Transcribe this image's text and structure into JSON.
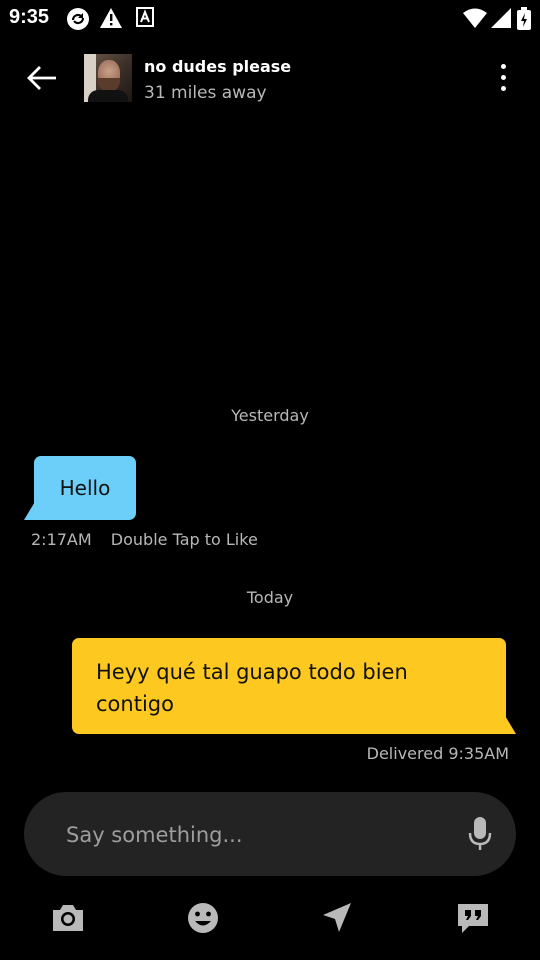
{
  "status_bar": {
    "time": "9:35",
    "icons": [
      "sync-icon",
      "warning-icon",
      "font-a-icon",
      "wifi-icon",
      "signal-icon",
      "battery-icon"
    ]
  },
  "header": {
    "contact_name": "no dudes please",
    "distance": "31 miles away",
    "icons": [
      "back-arrow-icon",
      "more-vert-icon"
    ]
  },
  "chat": {
    "date_yesterday": "Yesterday",
    "incoming": {
      "text": "Hello",
      "time": "2:17AM",
      "like_hint": "Double Tap to Like",
      "color": "#6ccff9"
    },
    "date_today": "Today",
    "outgoing": {
      "text": "Heyy qué tal guapo todo bien contigo",
      "status": "Delivered 9:35AM",
      "color": "#fdc81f"
    }
  },
  "composer": {
    "placeholder": "Say something...",
    "mic_icon": "microphone-icon"
  },
  "toolbar": {
    "items": [
      "camera-icon",
      "emoji-icon",
      "location-send-icon",
      "saved-phrases-icon"
    ]
  }
}
